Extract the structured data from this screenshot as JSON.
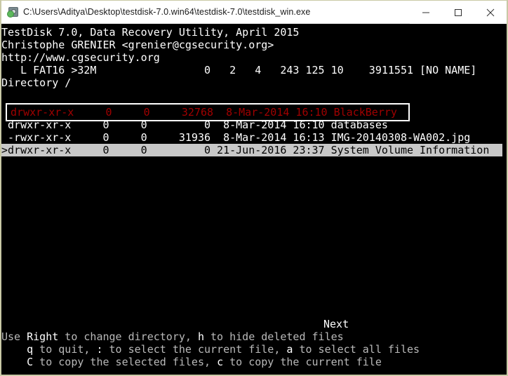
{
  "window": {
    "title": "C:\\Users\\Aditya\\Desktop\\testdisk-7.0.win64\\testdisk-7.0\\testdisk_win.exe",
    "icon": "testdisk-app-icon",
    "controls": {
      "minimize": "minimize-icon",
      "maximize": "maximize-icon",
      "close": "close-icon"
    }
  },
  "colors": {
    "terminal_bg": "#000000",
    "terminal_fg": "#cccccc",
    "bright_fg": "#ffffff",
    "deleted_red": "#a00000",
    "highlight_bg": "#c8c8c8",
    "highlight_fg": "#000000",
    "window_frame": "#c9c9a6",
    "titlebar_bg": "#ffffff"
  },
  "terminal": {
    "header": {
      "line1": "TestDisk 7.0, Data Recovery Utility, April 2015",
      "line2": "Christophe GRENIER <grenier@cgsecurity.org>",
      "line3": "http://www.cgsecurity.org",
      "partition_line": "   L FAT16 >32M                 0   2   4   243 125 10    3911551 [NO NAME]",
      "directory_line": "Directory /"
    },
    "partition": {
      "label": "L FAT16 >32M",
      "start_cylinder": "0",
      "start_head": "2",
      "start_sector": "4",
      "end_cylinder": "243",
      "end_head": "125",
      "end_sector": "10",
      "size_sectors": "3911551",
      "volume_name": "[NO NAME]"
    },
    "directory": "Directory /",
    "columns": [
      "permissions",
      "uid",
      "gid",
      "size",
      "date",
      "time",
      "name"
    ],
    "files": [
      {
        "marker": " ",
        "permissions": "drwxr-xr-x",
        "uid": "0",
        "gid": "0",
        "size": "32768",
        "date": "8-Mar-2014",
        "time": "16:10",
        "name": "BlackBerry",
        "state": "deleted",
        "boxed": true,
        "raw": " drwxr-xr-x     0     0     32768  8-Mar-2014 16:10 BlackBerry"
      },
      {
        "marker": " ",
        "permissions": "drwxr-xr-x",
        "uid": "0",
        "gid": "0",
        "size": "0",
        "date": "8-Mar-2014",
        "time": "16:10",
        "name": "databases",
        "state": "normal",
        "boxed": false,
        "raw": " drwxr-xr-x     0     0         0  8-Mar-2014 16:10 databases"
      },
      {
        "marker": " ",
        "permissions": "-rwxr-xr-x",
        "uid": "0",
        "gid": "0",
        "size": "31936",
        "date": "8-Mar-2014",
        "time": "16:13",
        "name": "IMG-20140308-WA002.jpg",
        "state": "normal",
        "boxed": false,
        "raw": " -rwxr-xr-x     0     0     31936  8-Mar-2014 16:13 IMG-20140308-WA002.jpg"
      },
      {
        "marker": ">",
        "permissions": "drwxr-xr-x",
        "uid": "0",
        "gid": "0",
        "size": "0",
        "date": "21-Jun-2016",
        "time": "23:37",
        "name": "System Volume Information",
        "state": "selected",
        "boxed": false,
        "raw": ">drwxr-xr-x     0     0         0 21-Jun-2016 23:37 System Volume Information"
      }
    ],
    "pager": {
      "next_label": "Next"
    },
    "help": [
      {
        "id": "help-line-1",
        "segments": [
          {
            "text": "Use ",
            "emphasis": false
          },
          {
            "text": "Right",
            "emphasis": true
          },
          {
            "text": " to change directory, ",
            "emphasis": false
          },
          {
            "text": "h",
            "emphasis": true
          },
          {
            "text": " to hide deleted files",
            "emphasis": false
          }
        ]
      },
      {
        "id": "help-line-2",
        "segments": [
          {
            "text": "    ",
            "emphasis": false
          },
          {
            "text": "q",
            "emphasis": true
          },
          {
            "text": " to quit, ",
            "emphasis": false
          },
          {
            "text": ":",
            "emphasis": true
          },
          {
            "text": " to select the current file, ",
            "emphasis": false
          },
          {
            "text": "a",
            "emphasis": true
          },
          {
            "text": " to select all files",
            "emphasis": false
          }
        ]
      },
      {
        "id": "help-line-3",
        "segments": [
          {
            "text": "    ",
            "emphasis": false
          },
          {
            "text": "C",
            "emphasis": true
          },
          {
            "text": " to copy the selected files, ",
            "emphasis": false
          },
          {
            "text": "c",
            "emphasis": true
          },
          {
            "text": " to copy the current file",
            "emphasis": false
          }
        ]
      }
    ]
  }
}
